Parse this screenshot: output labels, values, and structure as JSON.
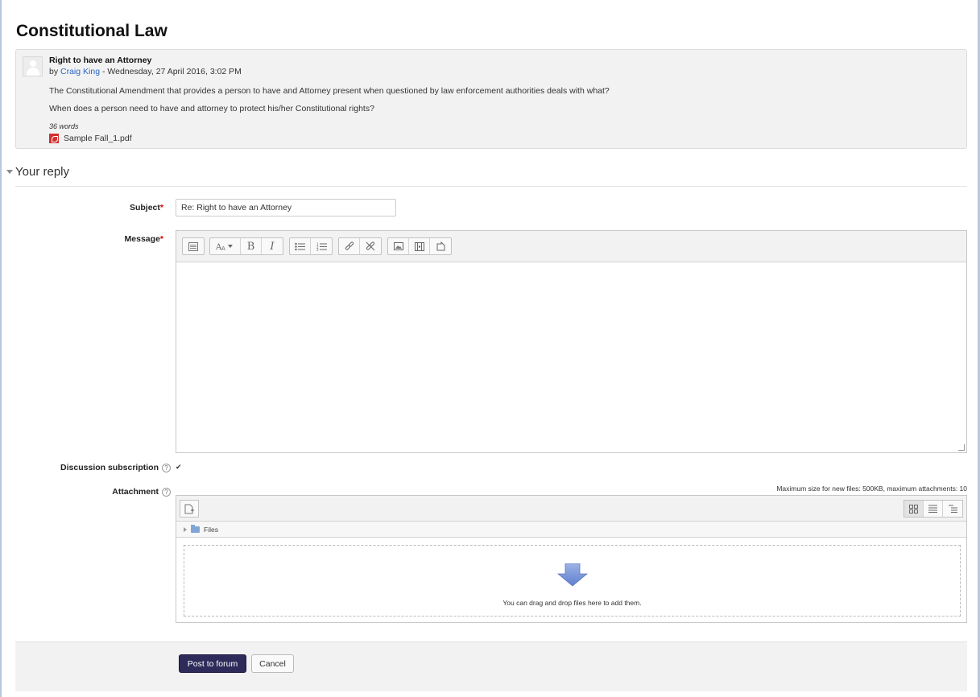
{
  "page": {
    "title": "Constitutional Law"
  },
  "post": {
    "subject": "Right to have an Attorney",
    "by_prefix": "by ",
    "author": "Craig King",
    "date": " - Wednesday, 27 April 2016, 3:02 PM",
    "paragraph1": "The Constitutional Amendment that provides a person to have and Attorney present when questioned by law enforcement authorities deals with what?",
    "paragraph2": "When does a person need to have and attorney to protect his/her Constitutional rights?",
    "word_count": "36 words",
    "attachment": "Sample Fall_1.pdf"
  },
  "reply": {
    "section_title": "Your reply",
    "subject_label": "Subject",
    "subject_value": "Re: Right to have an Attorney",
    "required_mark": "*",
    "message_label": "Message",
    "subscription_label": "Discussion subscription",
    "subscription_checked": "✔",
    "attachment_label": "Attachment",
    "help_mark": "?",
    "max_note": "Maximum size for new files: 500KB, maximum attachments: 10",
    "files_path": "Files",
    "drop_text": "You can drag and drop files here to add them."
  },
  "toolbar": {
    "bold": "B",
    "italic": "I"
  },
  "footer": {
    "post_button": "Post to forum",
    "cancel_button": "Cancel"
  },
  "colors": {
    "primary_button": "#2e2a5a",
    "link": "#2a66c4",
    "required": "#cc0000",
    "pdf_icon": "#d32f2f"
  }
}
